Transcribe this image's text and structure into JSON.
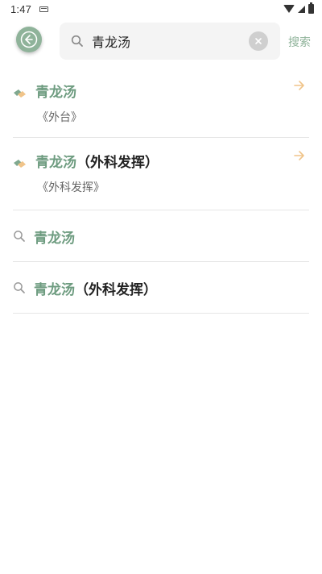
{
  "status_bar": {
    "time": "1:47"
  },
  "header": {
    "search_value": "青龙汤",
    "search_button_label": "搜索"
  },
  "results": [
    {
      "type": "book",
      "title": "青龙汤",
      "suffix": "",
      "source": "《外台》"
    },
    {
      "type": "book",
      "title": "青龙汤",
      "suffix": "（外科发挥）",
      "source": "《外科发挥》"
    },
    {
      "type": "search",
      "title": "青龙汤",
      "suffix": ""
    },
    {
      "type": "search",
      "title": "青龙汤",
      "suffix": "（外科发挥）"
    }
  ],
  "colors": {
    "accent": "#6e9c80",
    "back_button": "#8fb39a",
    "arrow": "#f0c48a",
    "book_icon": "#7fa88f"
  },
  "icons": {
    "back": "arrow-left-icon",
    "search": "search-icon",
    "clear": "close-icon",
    "book": "book-icon",
    "link": "arrow-right-icon"
  }
}
